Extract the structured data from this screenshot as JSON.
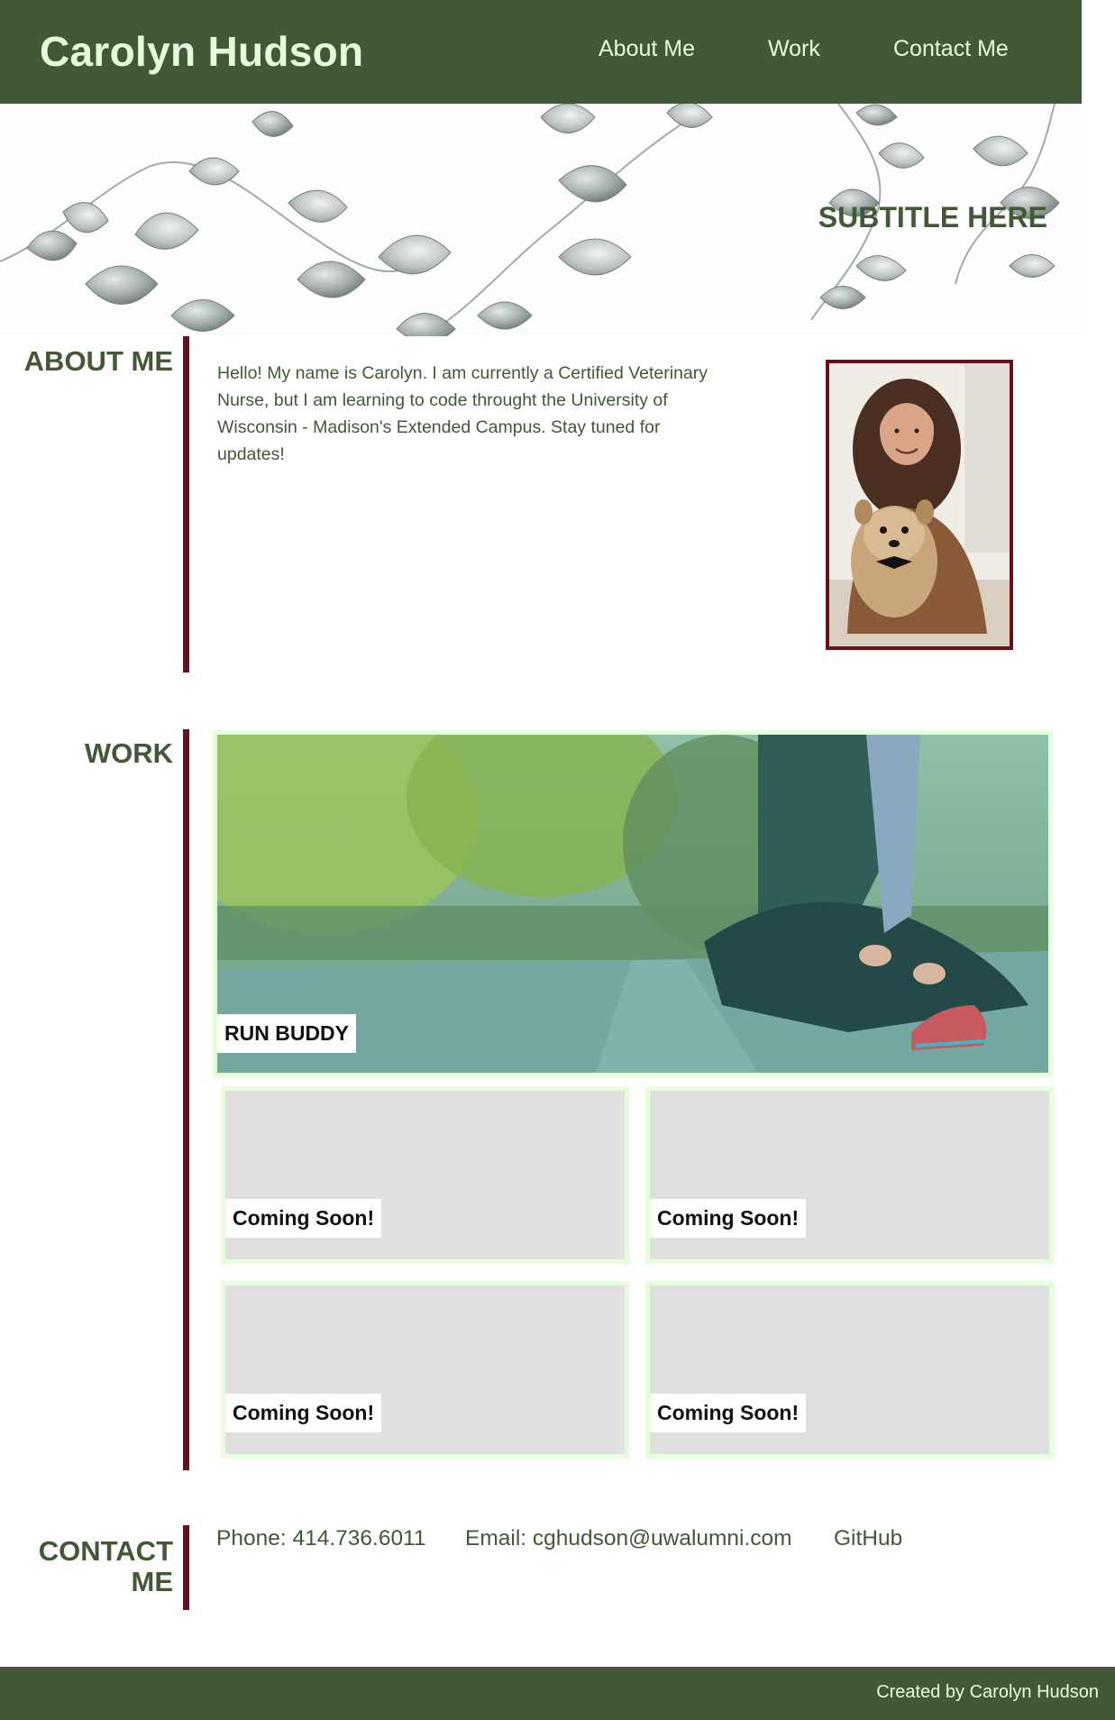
{
  "header": {
    "title": "Carolyn Hudson",
    "nav": [
      {
        "label": "About Me"
      },
      {
        "label": "Work"
      },
      {
        "label": "Contact Me"
      }
    ]
  },
  "hero": {
    "subtitle": "SUBTITLE HERE"
  },
  "about": {
    "heading": "ABOUT ME",
    "text": "Hello! My name is Carolyn. I am currently a Certified Veterinary Nurse, but I am learning to code throught the University of Wisconsin - Madison's Extended Campus. Stay tuned for updates!"
  },
  "work": {
    "heading": "WORK",
    "featured": {
      "label": "RUN BUDDY"
    },
    "projects": [
      {
        "label": "Coming Soon!"
      },
      {
        "label": "Coming Soon!"
      },
      {
        "label": "Coming Soon!"
      },
      {
        "label": "Coming Soon!"
      }
    ]
  },
  "contact": {
    "heading": "CONTACT ME",
    "phone": "Phone: 414.736.6011",
    "email": "Email: cghudson@uwalumni.com",
    "github": "GitHub"
  },
  "footer": {
    "text": "Created by Carolyn Hudson"
  },
  "colors": {
    "primary": "#425837",
    "accent": "#6b0f1a",
    "light": "#e6ffdb",
    "placeholder": "#e0e1de"
  }
}
